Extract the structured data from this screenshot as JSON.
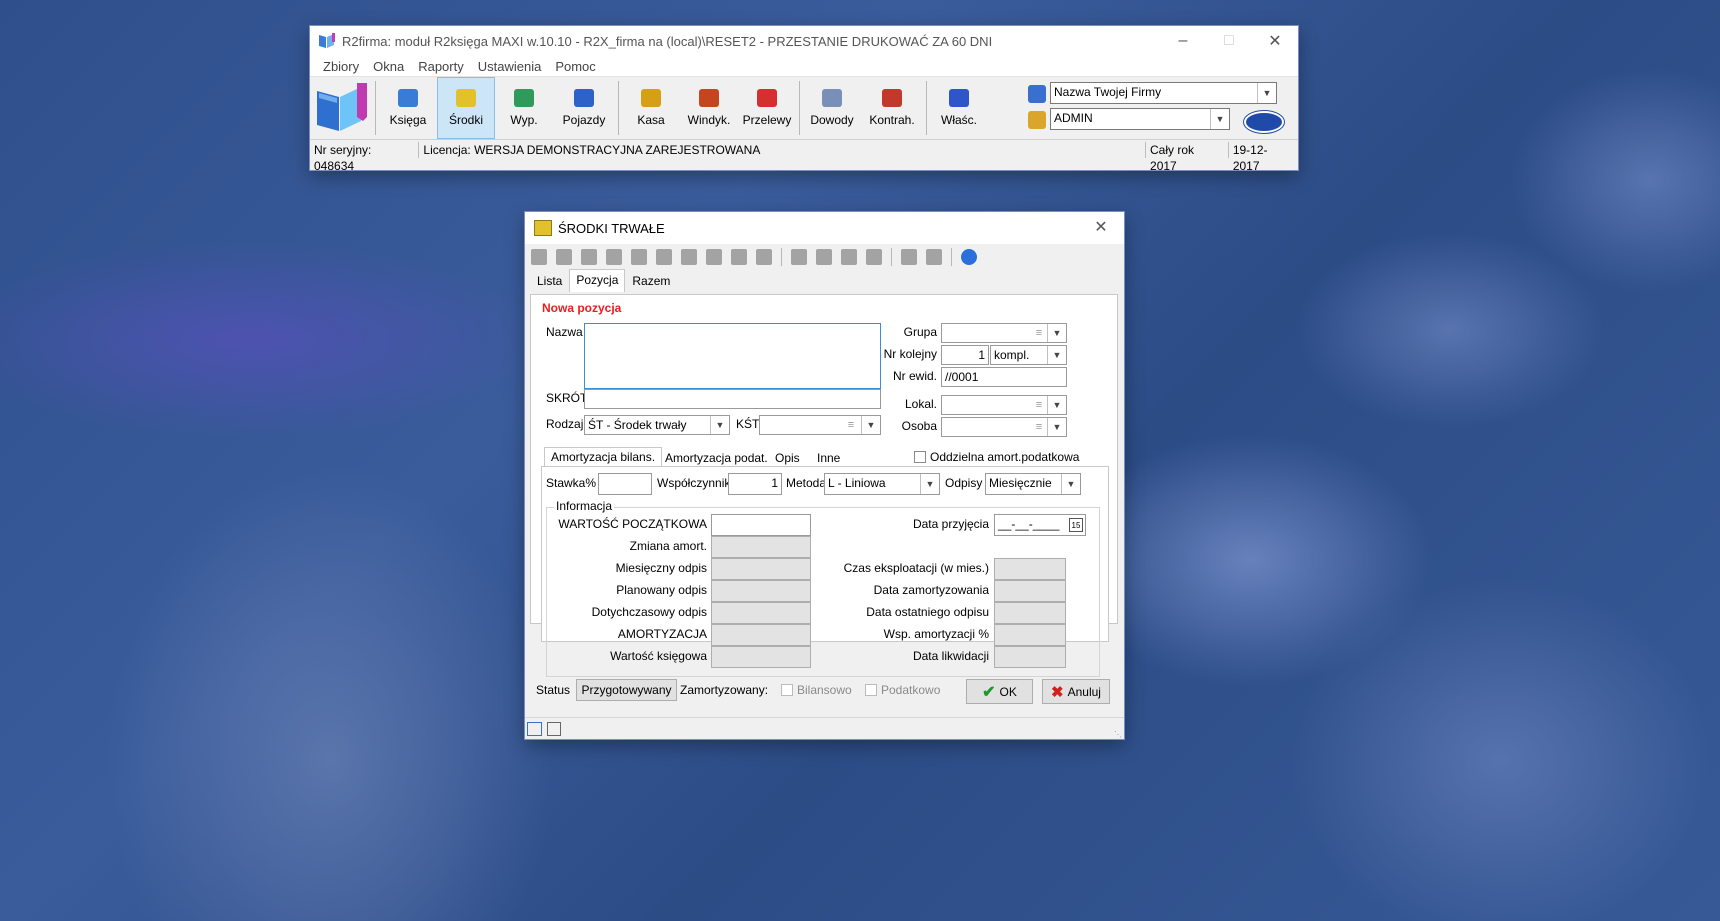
{
  "main_window": {
    "title": "R2firma: moduł R2księga MAXI w.10.10 - R2X_firma na (local)\\RESET2 - PRZESTANIE DRUKOWAĆ ZA 60 DNI",
    "menu": [
      "Zbiory",
      "Okna",
      "Raporty",
      "Ustawienia",
      "Pomoc"
    ],
    "toolbar": [
      {
        "label": "Księga",
        "icon": "book-icon",
        "color": "#3a7bd5"
      },
      {
        "label": "Środki",
        "icon": "monitor-icon",
        "color": "#e2c12c",
        "active": true
      },
      {
        "label": "Wyp.",
        "icon": "equipment-icon",
        "color": "#2f9a5a"
      },
      {
        "label": "Pojazdy",
        "icon": "car-icon",
        "color": "#2f62c9"
      },
      {
        "label": "Kasa",
        "icon": "cash-register-icon",
        "color": "#d6a016"
      },
      {
        "label": "Windyk.",
        "icon": "collection-icon",
        "color": "#c3461e"
      },
      {
        "label": "Przelewy",
        "icon": "transfer-icon",
        "color": "#d43030"
      },
      {
        "label": "Dowody",
        "icon": "documents-icon",
        "color": "#7a8fb8"
      },
      {
        "label": "Kontrah.",
        "icon": "contractors-icon",
        "color": "#c0392b"
      },
      {
        "label": "Właśc.",
        "icon": "owners-icon",
        "color": "#2e56c9"
      }
    ],
    "company_select": "Nazwa Twojej Firmy",
    "user_select": "ADMIN",
    "status": {
      "serial": "Nr seryjny: 048634",
      "license": "Licencja: WERSJA DEMONSTRACYJNA ZAREJESTROWANA",
      "period": "Cały rok 2017",
      "date": "19-12-2017"
    }
  },
  "dialog": {
    "title": "ŚRODKI TRWAŁE",
    "tabs": [
      "Lista",
      "Pozycja",
      "Razem"
    ],
    "selected_tab": "Pozycja",
    "section_title": "Nowa pozycja",
    "labels": {
      "nazwa": "Nazwa",
      "skrot": "SKRÓT",
      "rodzaj": "Rodzaj",
      "kst": "KŚT",
      "grupa": "Grupa",
      "nr_kolejny": "Nr kolejny",
      "nr_ewid": "Nr ewid.",
      "lokal": "Lokal.",
      "osoba": "Osoba",
      "stawka": "Stawka%",
      "wspolczynnik": "Współczynnik",
      "metoda": "Metoda",
      "odpisy": "Odpisy",
      "informacja": "Informacja",
      "data_przyjecia": "Data przyjęcia",
      "status": "Status",
      "zamortyzowany": "Zamortyzowany:",
      "bilansowo": "Bilansowo",
      "podatkowo": "Podatkowo",
      "oddzielna": "Oddzielna amort.podatkowa"
    },
    "values": {
      "rodzaj": "ŚT - Środek trwały",
      "nr_kolejny": "1",
      "kompl": "kompl.",
      "nr_ewid": "//0001",
      "wspolczynnik": "1",
      "metoda": "L - Liniowa",
      "odpisy": "Miesięcznie",
      "data_przyjecia": "__-__-____",
      "status": "Przygotowywany"
    },
    "sub_tabs": [
      "Amortyzacja bilans.",
      "Amortyzacja podat.",
      "Opis",
      "Inne"
    ],
    "info_left": [
      "WARTOŚĆ POCZĄTKOWA",
      "Zmiana amort.",
      "Miesięczny odpis",
      "Planowany odpis",
      "Dotychczasowy odpis",
      "AMORTYZACJA",
      "Wartość księgowa"
    ],
    "info_right": [
      "Czas eksploatacji (w mies.)",
      "Data zamortyzowania",
      "Data ostatniego odpisu",
      "Wsp. amortyzacji %",
      "Data likwidacji"
    ],
    "buttons": {
      "ok": "OK",
      "cancel": "Anuluj"
    },
    "accent_color": "#e8201c"
  }
}
